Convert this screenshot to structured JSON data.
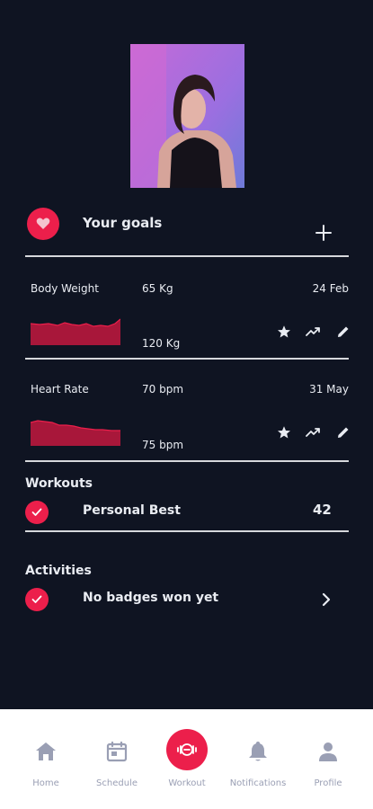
{
  "goals": {
    "title": "Your goals"
  },
  "metrics": [
    {
      "name": "Body Weight",
      "value": "65 Kg",
      "date": "24 Feb",
      "target": "120 Kg"
    },
    {
      "name": "Heart Rate",
      "value": "70 bpm",
      "date": "31 May",
      "target": "75 bpm"
    }
  ],
  "workouts": {
    "title": "Workouts",
    "label": "Personal Best",
    "count": "42"
  },
  "activities": {
    "title": "Activities",
    "label": "No badges won yet"
  },
  "nav": {
    "items": [
      {
        "label": "Home",
        "icon": "home-icon"
      },
      {
        "label": "Schedule",
        "icon": "calendar-icon"
      },
      {
        "label": "Workout",
        "icon": "workout-icon",
        "active": true
      },
      {
        "label": "Notifications",
        "icon": "bell-icon"
      },
      {
        "label": "Profile",
        "icon": "user-icon"
      }
    ]
  },
  "colors": {
    "background": "#0f1422",
    "accent": "#ec1f4b",
    "sparkline": "#a8173a",
    "nav_text": "#9a9fb4",
    "divider": "#d6d8dc"
  }
}
